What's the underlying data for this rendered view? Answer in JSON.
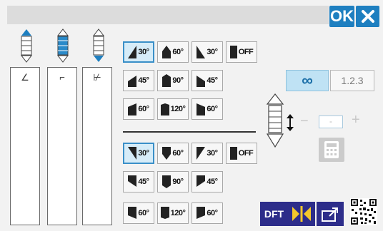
{
  "header": {
    "ok_label": "OK",
    "close_icon": "close-icon"
  },
  "columns": [
    {
      "name": "column-1",
      "icon": "column-up-icon",
      "mark": "∠"
    },
    {
      "name": "column-2",
      "icon": "column-both-icon",
      "mark": "⌐"
    },
    {
      "name": "column-3",
      "icon": "column-down-icon",
      "mark": "⊬"
    }
  ],
  "top_patterns": [
    {
      "label": "30°",
      "selected": true
    },
    {
      "label": "60°",
      "selected": false
    },
    {
      "label": "30°",
      "selected": false
    },
    {
      "label": "OFF",
      "selected": false
    },
    {
      "label": "45°",
      "selected": false
    },
    {
      "label": "90°",
      "selected": false
    },
    {
      "label": "45°",
      "selected": false
    },
    {
      "label": "60°",
      "selected": false
    },
    {
      "label": "120°",
      "selected": false
    },
    {
      "label": "60°",
      "selected": false
    }
  ],
  "bottom_patterns": [
    {
      "label": "30°",
      "selected": true
    },
    {
      "label": "60°",
      "selected": false
    },
    {
      "label": "30°",
      "selected": false
    },
    {
      "label": "OFF",
      "selected": false
    },
    {
      "label": "45°",
      "selected": false
    },
    {
      "label": "90°",
      "selected": false
    },
    {
      "label": "45°",
      "selected": false
    },
    {
      "label": "60°",
      "selected": false
    },
    {
      "label": "120°",
      "selected": false
    },
    {
      "label": "60°",
      "selected": false
    }
  ],
  "mode": {
    "infinite_label": "∞",
    "count_label": "1.2.3"
  },
  "stepper": {
    "minus_label": "−",
    "value": "-",
    "plus_label": "+"
  },
  "footer": {
    "dft_label": "DFT"
  },
  "colors": {
    "accent": "#1e7fc0",
    "selected_bg": "#d6ecf8",
    "footer_bg": "#2d2d8a",
    "mirror_yellow": "#f3c82b"
  }
}
